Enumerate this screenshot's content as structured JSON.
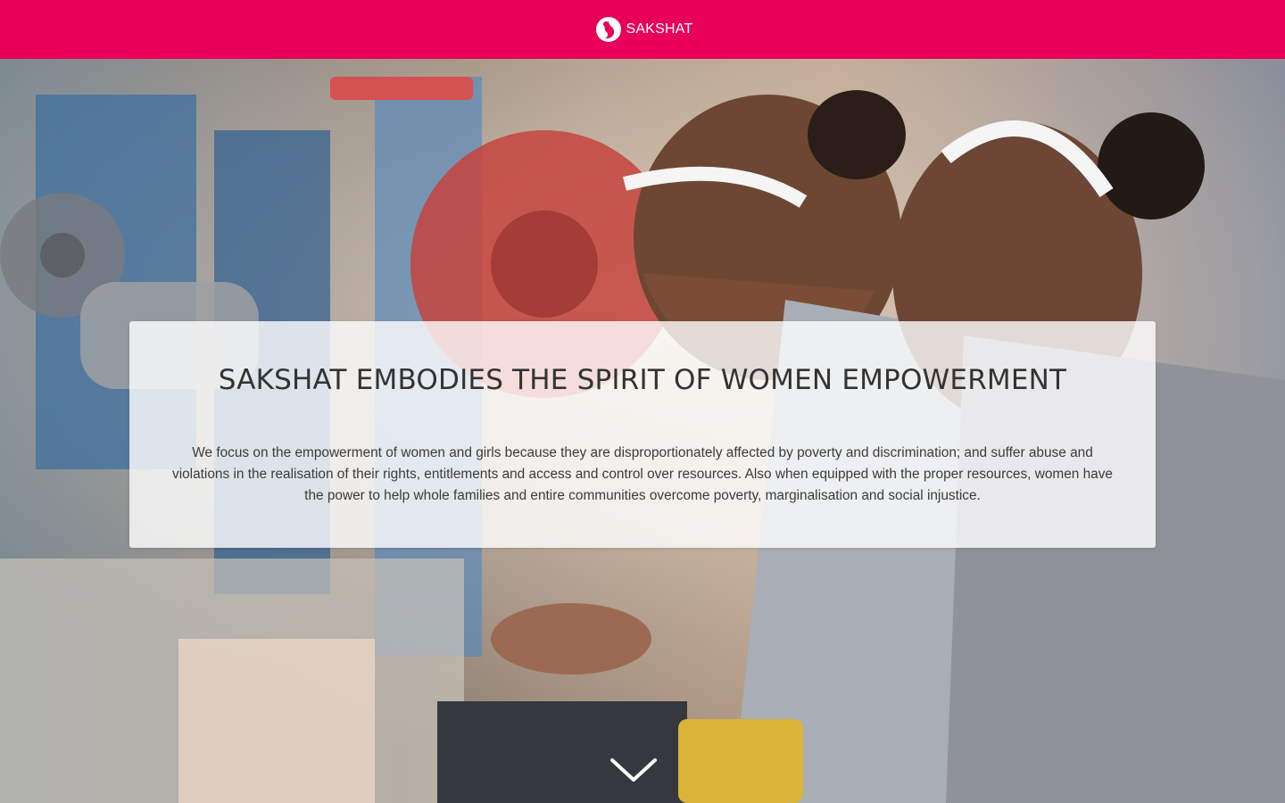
{
  "header": {
    "brand": "SAKSHAT",
    "background_color": "#e8005a",
    "logo_icon": "sakshat-logo-icon"
  },
  "hero": {
    "image_description_icon": "women-factory-workers-photo",
    "headline": "SAKSHAT EMBODIES THE SPIRIT OF WOMEN EMPOWERMENT",
    "body": "We focus on the empowerment of women and girls because they are disproportionately affected by poverty and discrimination; and suffer abuse and violations in the realisation of their rights, entitlements and access and control over resources. Also when equipped with the proper resources, women have the power to help whole families and entire communities overcome poverty, marginalisation and social injustice.",
    "scroll_icon": "chevron-down-icon"
  }
}
